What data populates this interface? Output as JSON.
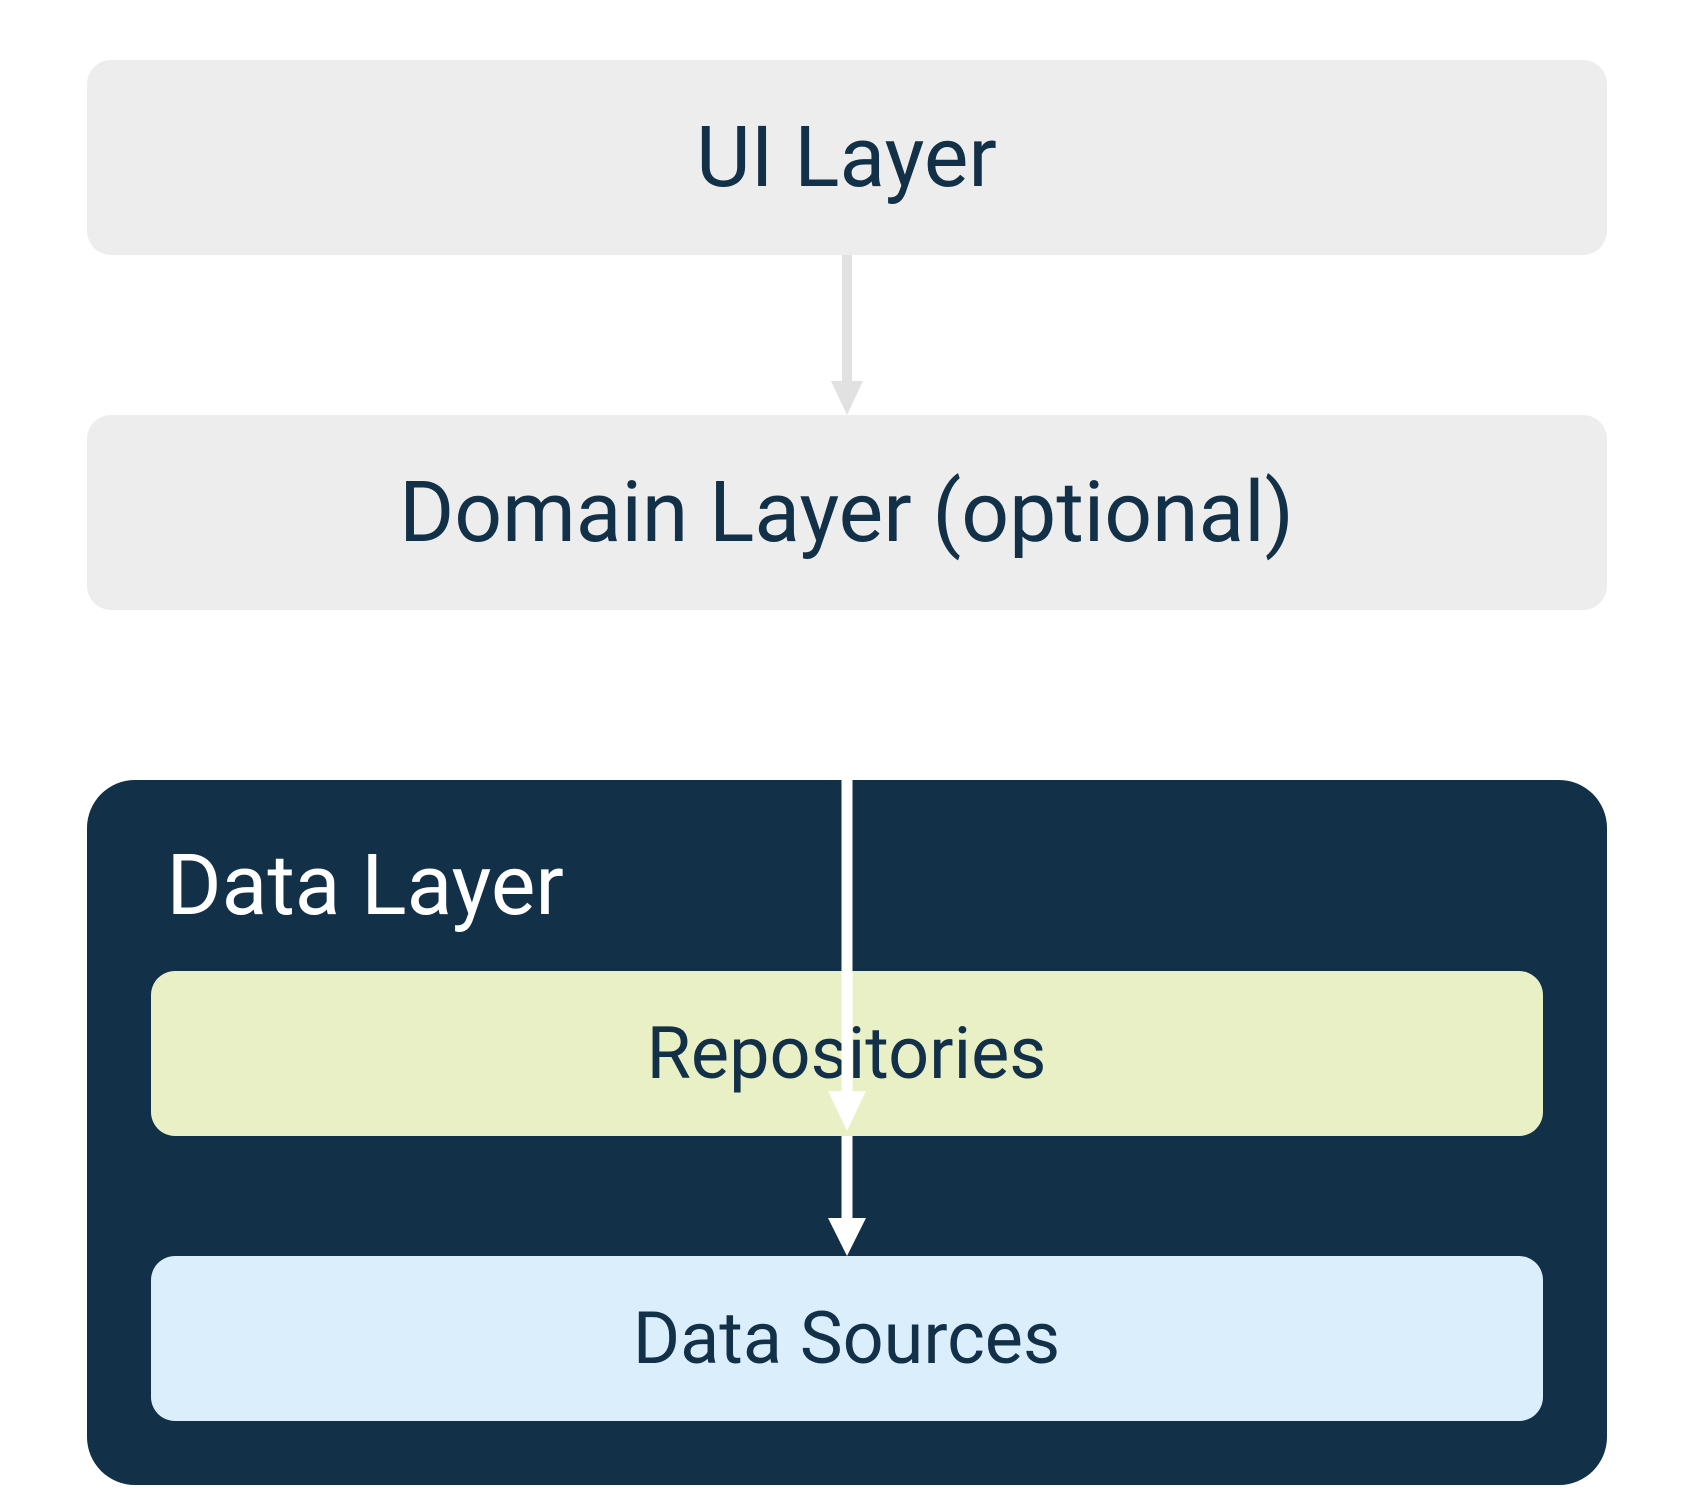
{
  "layers": {
    "ui": "UI Layer",
    "domain": "Domain Layer (optional)",
    "data_title": "Data Layer",
    "repositories": "Repositories",
    "data_sources": "Data Sources"
  },
  "colors": {
    "light_gray": "#ededed",
    "dark_navy": "#123047",
    "pale_green": "#eaf0c6",
    "pale_blue": "#dbeefc",
    "arrow_gray": "#e1e1e1",
    "arrow_white": "#ffffff"
  }
}
